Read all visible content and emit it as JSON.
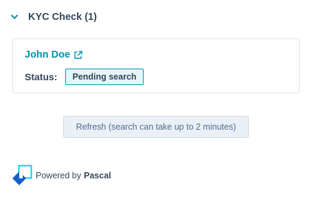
{
  "section": {
    "title": "KYC Check (1)",
    "expanded": true
  },
  "record": {
    "name": "John Doe",
    "status_label": "Status:",
    "status_value": "Pending search"
  },
  "actions": {
    "refresh_label": "Refresh (search can take up to 2 minutes)"
  },
  "footer": {
    "powered_by": "Powered by",
    "brand": "Pascal"
  },
  "colors": {
    "accent": "#0091ae",
    "text": "#33475b",
    "logo_blue": "#1261c9",
    "logo_cyan": "#00d2e6"
  }
}
